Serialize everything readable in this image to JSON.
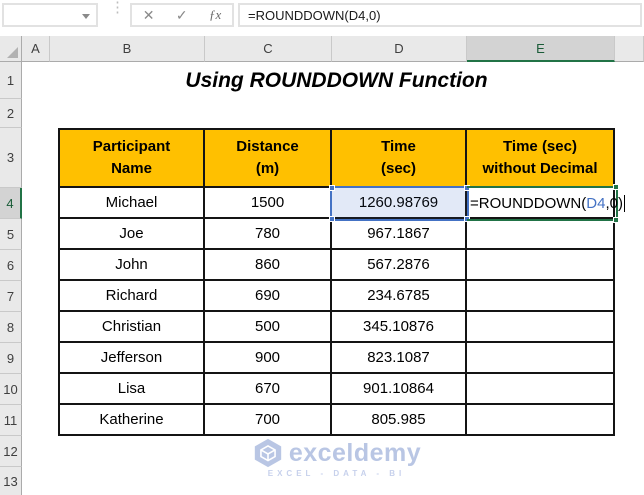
{
  "formula_bar": {
    "name_box_value": "",
    "cancel_icon": "✕",
    "enter_icon": "✓",
    "fx_label": "ƒx",
    "formula": "=ROUNDDOWN(D4,0)"
  },
  "column_headers": [
    "A",
    "B",
    "C",
    "D",
    "E"
  ],
  "row_headers": [
    "1",
    "2",
    "3",
    "4",
    "5",
    "6",
    "7",
    "8",
    "9",
    "10",
    "11",
    "12",
    "13"
  ],
  "active_cell": {
    "column": "E",
    "row": "4"
  },
  "title": "Using ROUNDDOWN Function",
  "table": {
    "headers": [
      {
        "line1": "Participant",
        "line2": "Name"
      },
      {
        "line1": "Distance",
        "line2": "(m)"
      },
      {
        "line1": "Time",
        "line2": "(sec)"
      },
      {
        "line1": "Time (sec)",
        "line2": "without Decimal"
      }
    ],
    "rows": [
      {
        "name": "Michael",
        "distance": "1500",
        "time": "1260.98769",
        "result": ""
      },
      {
        "name": "Joe",
        "distance": "780",
        "time": "967.1867",
        "result": ""
      },
      {
        "name": "John",
        "distance": "860",
        "time": "567.2876",
        "result": ""
      },
      {
        "name": "Richard",
        "distance": "690",
        "time": "234.6785",
        "result": ""
      },
      {
        "name": "Christian",
        "distance": "500",
        "time": "345.10876",
        "result": ""
      },
      {
        "name": "Jefferson",
        "distance": "900",
        "time": "823.1087",
        "result": ""
      },
      {
        "name": "Lisa",
        "distance": "670",
        "time": "901.10864",
        "result": ""
      },
      {
        "name": "Katherine",
        "distance": "700",
        "time": "805.985",
        "result": ""
      }
    ]
  },
  "formula_cell": {
    "prefix": "=ROUNDDOWN(",
    "ref": "D4",
    "suffix": ",0)"
  },
  "watermark": {
    "brand": "exceldemy",
    "tagline": "EXCEL - DATA - BI"
  },
  "colors": {
    "table_header_fill": "#FFC000",
    "accent_green": "#217346",
    "reference_blue": "#4472C4",
    "watermark_blue": "#B9C6E4"
  }
}
